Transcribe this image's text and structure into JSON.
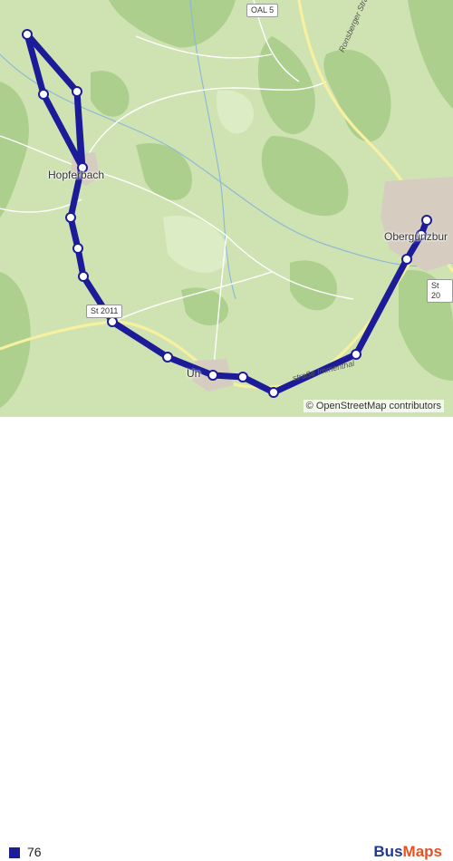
{
  "map": {
    "places": {
      "hopferbach": "Hopferbach",
      "untrasried": "Un",
      "obergunzburg": "Obergünzbur"
    },
    "roads": {
      "oal5": "OAL 5",
      "st2011": "St 2011",
      "st20": "St 20",
      "ronsberger": "Ronsberger Straße",
      "immenthal": "straße Immenthal"
    },
    "route": {
      "color": "#1c1c99",
      "stops": 14
    }
  },
  "attribution": "© OpenStreetMap contributors",
  "legend": {
    "line": "76",
    "color": "#1c1c99"
  },
  "brand": {
    "part1": "Bus",
    "part2": "Maps"
  }
}
